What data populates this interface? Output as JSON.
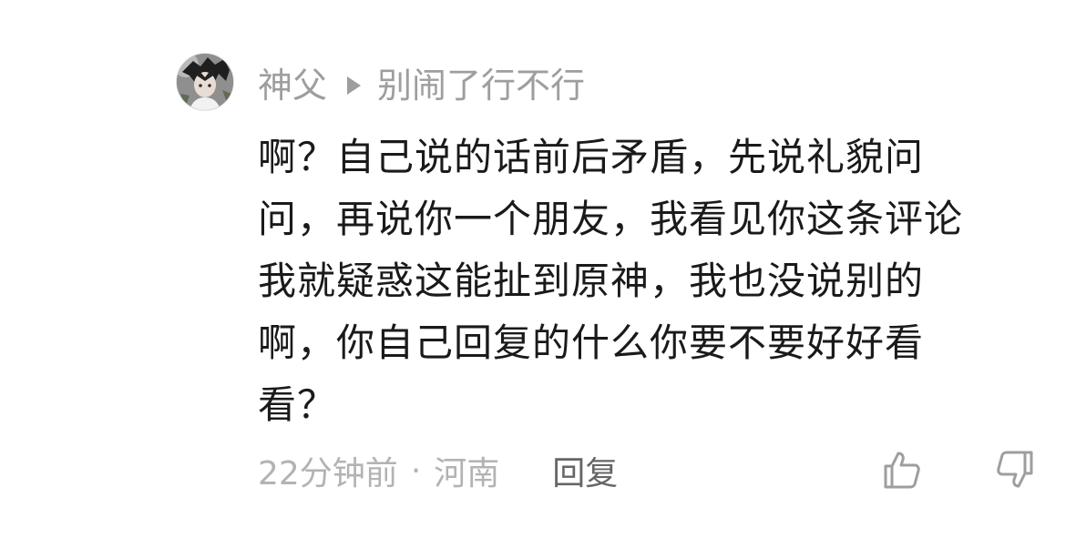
{
  "comment": {
    "username": "神父",
    "reply_to": "别闹了行不行",
    "avatar_icon": "user-avatar",
    "text_lines": [
      "啊？自己说的话前后矛盾，先说礼貌问",
      "问，再说你一个朋友，我看见你这条评论",
      "我就疑惑这能扯到原神，我也没说别的",
      "啊，你自己回复的什么你要不要好好看",
      "看？"
    ],
    "time": "22分钟前",
    "separator": "·",
    "location": "河南",
    "reply_label": "回复",
    "like_icon": "thumbs-up-icon",
    "dislike_icon": "thumbs-down-icon"
  },
  "colors": {
    "meta_gray": "#9e9e9e",
    "body_text": "#1a1a1a",
    "footer_gray": "#b3b3b3",
    "reply_gray": "#666666",
    "icon_gray": "#9e9e9e"
  }
}
